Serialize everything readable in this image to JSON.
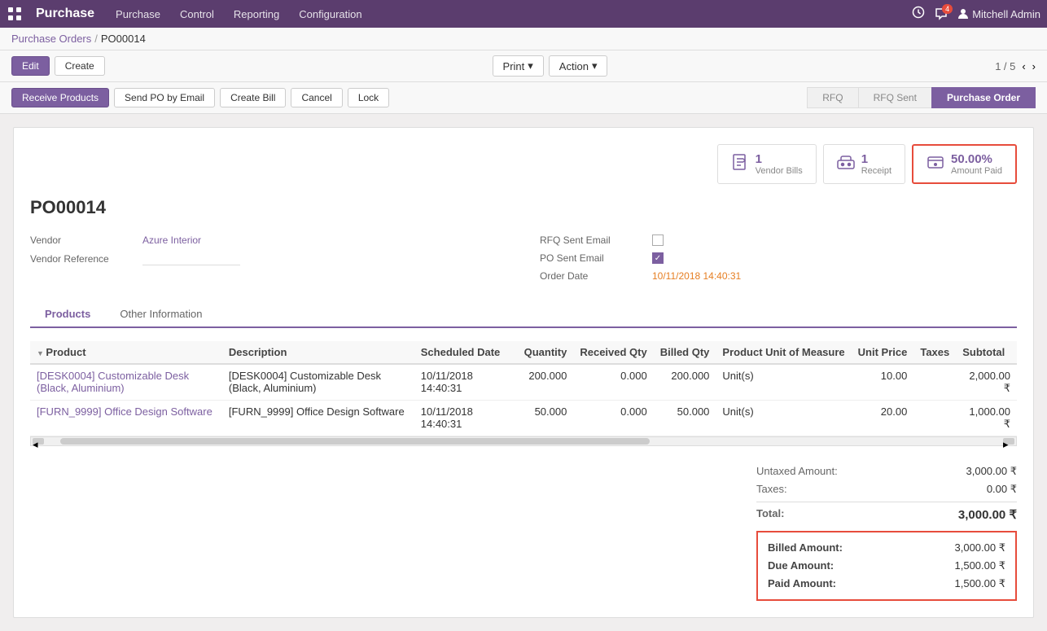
{
  "app": {
    "title": "Purchase",
    "nav_links": [
      "Purchase",
      "Control",
      "Reporting",
      "Configuration"
    ],
    "icons": {
      "grid": "⊞",
      "chat": "💬",
      "chat_badge": "4",
      "clock": "🕐",
      "user_icon": "👤"
    },
    "user": "Mitchell Admin"
  },
  "breadcrumb": {
    "parent": "Purchase Orders",
    "current": "PO00014"
  },
  "top_buttons": {
    "edit": "Edit",
    "create": "Create"
  },
  "middle_buttons": {
    "print": "Print",
    "action": "Action"
  },
  "page_nav": {
    "current": "1",
    "total": "5"
  },
  "doc_actions": {
    "receive_products": "Receive Products",
    "send_po_by_email": "Send PO by Email",
    "create_bill": "Create Bill",
    "cancel": "Cancel",
    "lock": "Lock"
  },
  "workflow": {
    "steps": [
      "RFQ",
      "RFQ Sent",
      "Purchase Order"
    ],
    "active": "Purchase Order"
  },
  "po": {
    "number": "PO00014",
    "vendor_label": "Vendor",
    "vendor_value": "Azure Interior",
    "vendor_reference_label": "Vendor Reference",
    "vendor_reference_value": "",
    "rfq_sent_email_label": "RFQ Sent Email",
    "rfq_sent_email_checked": false,
    "po_sent_email_label": "PO Sent Email",
    "po_sent_email_checked": true,
    "order_date_label": "Order Date",
    "order_date_value": "10/11/2018 14:40:31"
  },
  "stat_buttons": [
    {
      "id": "vendor_bills",
      "icon": "📄",
      "count": "1",
      "label": "Vendor Bills",
      "highlighted": false
    },
    {
      "id": "receipt",
      "icon": "🚚",
      "count": "1",
      "label": "Receipt",
      "highlighted": false
    },
    {
      "id": "amount_paid",
      "icon": "💳",
      "count": "50.00%",
      "label": "Amount Paid",
      "highlighted": true
    }
  ],
  "tabs": [
    {
      "id": "products",
      "label": "Products",
      "active": true
    },
    {
      "id": "other_info",
      "label": "Other Information",
      "active": false
    }
  ],
  "table": {
    "columns": [
      {
        "id": "product",
        "label": "Product",
        "sort": true
      },
      {
        "id": "description",
        "label": "Description"
      },
      {
        "id": "scheduled_date",
        "label": "Scheduled Date"
      },
      {
        "id": "quantity",
        "label": "Quantity"
      },
      {
        "id": "received_qty",
        "label": "Received Qty"
      },
      {
        "id": "billed_qty",
        "label": "Billed Qty"
      },
      {
        "id": "unit_of_measure",
        "label": "Product Unit of Measure"
      },
      {
        "id": "unit_price",
        "label": "Unit Price"
      },
      {
        "id": "taxes",
        "label": "Taxes"
      },
      {
        "id": "subtotal",
        "label": "Subtotal"
      }
    ],
    "rows": [
      {
        "product": "[DESK0004] Customizable Desk (Black, Aluminium)",
        "description": "[DESK0004] Customizable Desk (Black, Aluminium)",
        "scheduled_date": "10/11/2018 14:40:31",
        "quantity": "200.000",
        "received_qty": "0.000",
        "billed_qty": "200.000",
        "unit_of_measure": "Unit(s)",
        "unit_price": "10.00",
        "taxes": "",
        "subtotal": "2,000.00 ₹"
      },
      {
        "product": "[FURN_9999] Office Design Software",
        "description": "[FURN_9999] Office Design Software",
        "scheduled_date": "10/11/2018 14:40:31",
        "quantity": "50.000",
        "received_qty": "0.000",
        "billed_qty": "50.000",
        "unit_of_measure": "Unit(s)",
        "unit_price": "20.00",
        "taxes": "",
        "subtotal": "1,000.00 ₹"
      }
    ]
  },
  "totals": {
    "untaxed_amount_label": "Untaxed Amount:",
    "untaxed_amount_value": "3,000.00 ₹",
    "taxes_label": "Taxes:",
    "taxes_value": "0.00 ₹",
    "total_label": "Total:",
    "total_value": "3,000.00 ₹",
    "billed_amount_label": "Billed Amount:",
    "billed_amount_value": "3,000.00 ₹",
    "due_amount_label": "Due Amount:",
    "due_amount_value": "1,500.00 ₹",
    "paid_amount_label": "Paid Amount:",
    "paid_amount_value": "1,500.00 ₹"
  }
}
